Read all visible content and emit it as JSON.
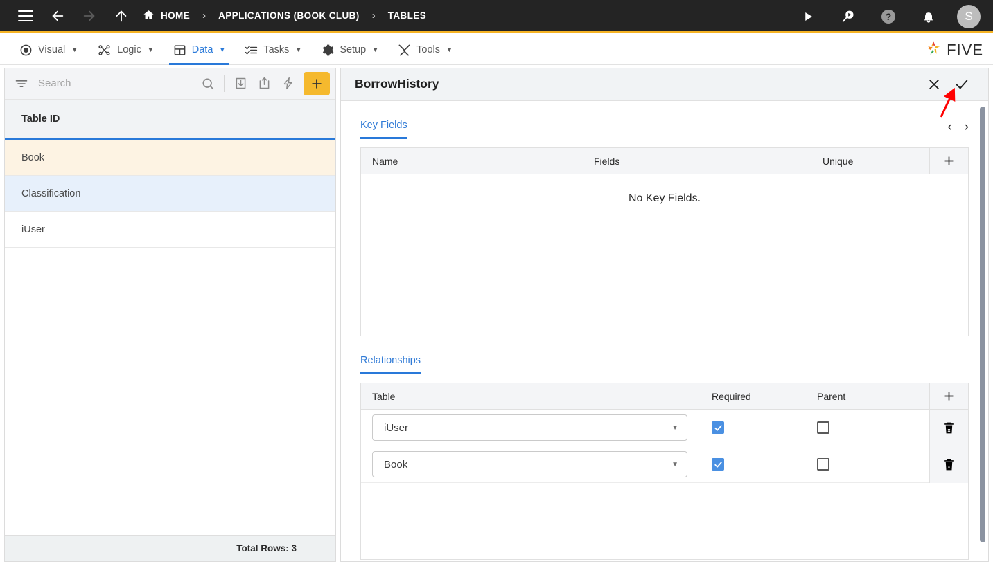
{
  "topbar": {
    "icons": [
      "menu-icon",
      "back-arrow-icon",
      "forward-arrow-icon",
      "up-arrow-icon"
    ],
    "breadcrumb": [
      {
        "label": "HOME",
        "icon": "home-icon"
      },
      {
        "label": "APPLICATIONS (BOOK CLUB)",
        "icon": ""
      },
      {
        "label": "TABLES",
        "icon": ""
      }
    ],
    "separator": "›",
    "right_icons": [
      "play-icon",
      "search-run-icon",
      "help-icon",
      "bell-icon"
    ],
    "avatar_initial": "S"
  },
  "menubar": {
    "items": [
      {
        "label": "Visual",
        "icon": "eye-icon",
        "active": false
      },
      {
        "label": "Logic",
        "icon": "logic-nodes-icon",
        "active": false
      },
      {
        "label": "Data",
        "icon": "grid-icon",
        "active": true
      },
      {
        "label": "Tasks",
        "icon": "checklist-icon",
        "active": false
      },
      {
        "label": "Setup",
        "icon": "gear-icon",
        "active": false
      },
      {
        "label": "Tools",
        "icon": "tools-icon",
        "active": false
      }
    ],
    "caret": "▼",
    "brand": "FIVE"
  },
  "left_panel": {
    "search": {
      "placeholder": "Search",
      "value": ""
    },
    "toolbar_icons": [
      "filter-icon",
      "search-icon",
      "import-icon",
      "export-icon",
      "lightning-icon",
      "add-icon"
    ],
    "column_header": "Table ID",
    "rows": [
      {
        "label": "Book",
        "state": "selected"
      },
      {
        "label": "Classification",
        "state": "highlighted"
      },
      {
        "label": "iUser",
        "state": "normal"
      }
    ],
    "status": "Total Rows: 3"
  },
  "right_panel": {
    "title": "BorrowHistory",
    "actions": [
      {
        "name": "close-button",
        "glyph": "✕"
      },
      {
        "name": "confirm-button",
        "glyph": "✓"
      }
    ],
    "key_fields": {
      "tab_label": "Key Fields",
      "nav_prev": "‹",
      "nav_next": "›",
      "columns": [
        "Name",
        "Fields",
        "Unique"
      ],
      "add_glyph": "+",
      "empty_message": "No Key Fields."
    },
    "relationships": {
      "tab_label": "Relationships",
      "columns": [
        "Table",
        "Required",
        "Parent"
      ],
      "add_glyph": "+",
      "rows": [
        {
          "table": "iUser",
          "required": true,
          "parent": false
        },
        {
          "table": "Book",
          "required": true,
          "parent": false
        }
      ]
    }
  },
  "colors": {
    "topbar_bg": "#242424",
    "accent_yellow": "#F5B324",
    "accent_blue": "#2979d9",
    "row_selected": "#FDF3E3",
    "row_highlight": "#E7F0FB",
    "checkbox_on": "#4A90E2",
    "annotation_arrow": "#FF0000"
  }
}
